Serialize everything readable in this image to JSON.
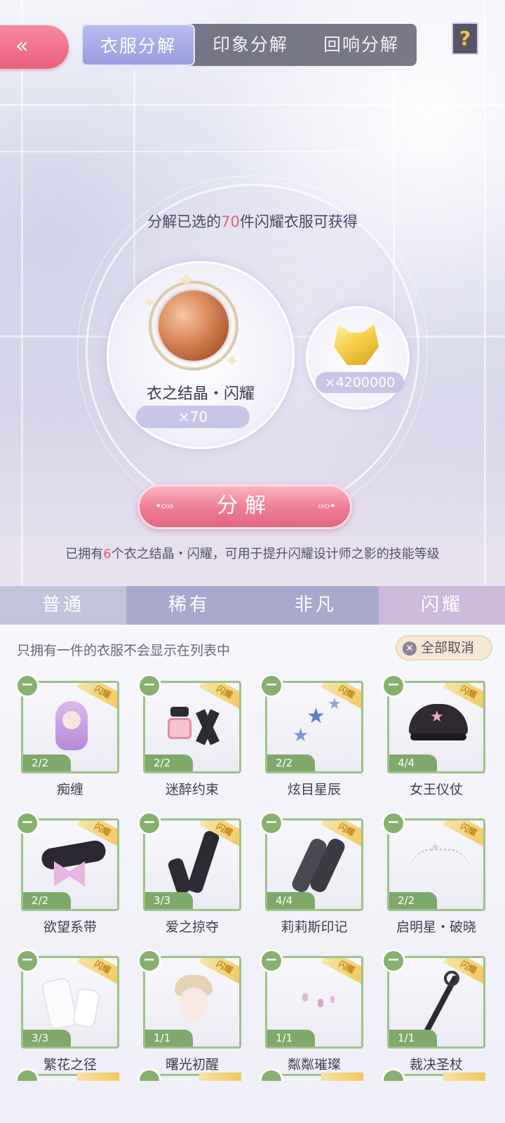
{
  "top_tabs": [
    "衣服分解",
    "印象分解",
    "回响分解"
  ],
  "active_top_tab": 0,
  "back_symbol": "«",
  "help_symbol": "?",
  "summary": {
    "prefix": "分解已选的",
    "count": "70",
    "suffix": "件闪耀衣服可获得"
  },
  "reward_crystal": {
    "name": "衣之结晶・闪耀",
    "count": "×70"
  },
  "reward_gold": {
    "count": "×4200000"
  },
  "decompose_button": "分解",
  "owned": {
    "prefix": "已拥有",
    "count": "6",
    "suffix": "个衣之结晶・闪耀，可用于提升闪耀设计师之影的技能等级"
  },
  "rarity_tabs": [
    "普通",
    "稀有",
    "非凡",
    "闪耀"
  ],
  "active_rarity_tab": 3,
  "hint": "只拥有一件的衣服不会显示在列表中",
  "cancel_all": "全部取消",
  "rarity_badge": "闪耀",
  "items": [
    {
      "name": "痴缠",
      "count": "2/2",
      "icon": "hair-icon"
    },
    {
      "name": "迷醉约束",
      "count": "2/2",
      "icon": "bracelet-icon"
    },
    {
      "name": "炫目星辰",
      "count": "2/2",
      "icon": "star-earring-icon"
    },
    {
      "name": "女王仪仗",
      "count": "4/4",
      "icon": "cap-icon"
    },
    {
      "name": "欲望系带",
      "count": "2/2",
      "icon": "choker-icon"
    },
    {
      "name": "爱之掠夺",
      "count": "3/3",
      "icon": "gloves-icon"
    },
    {
      "name": "莉莉斯印记",
      "count": "4/4",
      "icon": "stockings-icon"
    },
    {
      "name": "启明星・破晓",
      "count": "2/2",
      "icon": "tiara-icon"
    },
    {
      "name": "繁花之径",
      "count": "3/3",
      "icon": "shoes-icon"
    },
    {
      "name": "曙光初醒",
      "count": "1/1",
      "icon": "face-icon"
    },
    {
      "name": "粼粼璀璨",
      "count": "1/1",
      "icon": "earring-icon"
    },
    {
      "name": "裁决圣杖",
      "count": "1/1",
      "icon": "scepter-icon"
    }
  ],
  "colors": {
    "accent_pink": "#e9607c",
    "tab_active": "#9a9de0",
    "item_border": "#9dc28a",
    "highlight": "#d9607c"
  }
}
